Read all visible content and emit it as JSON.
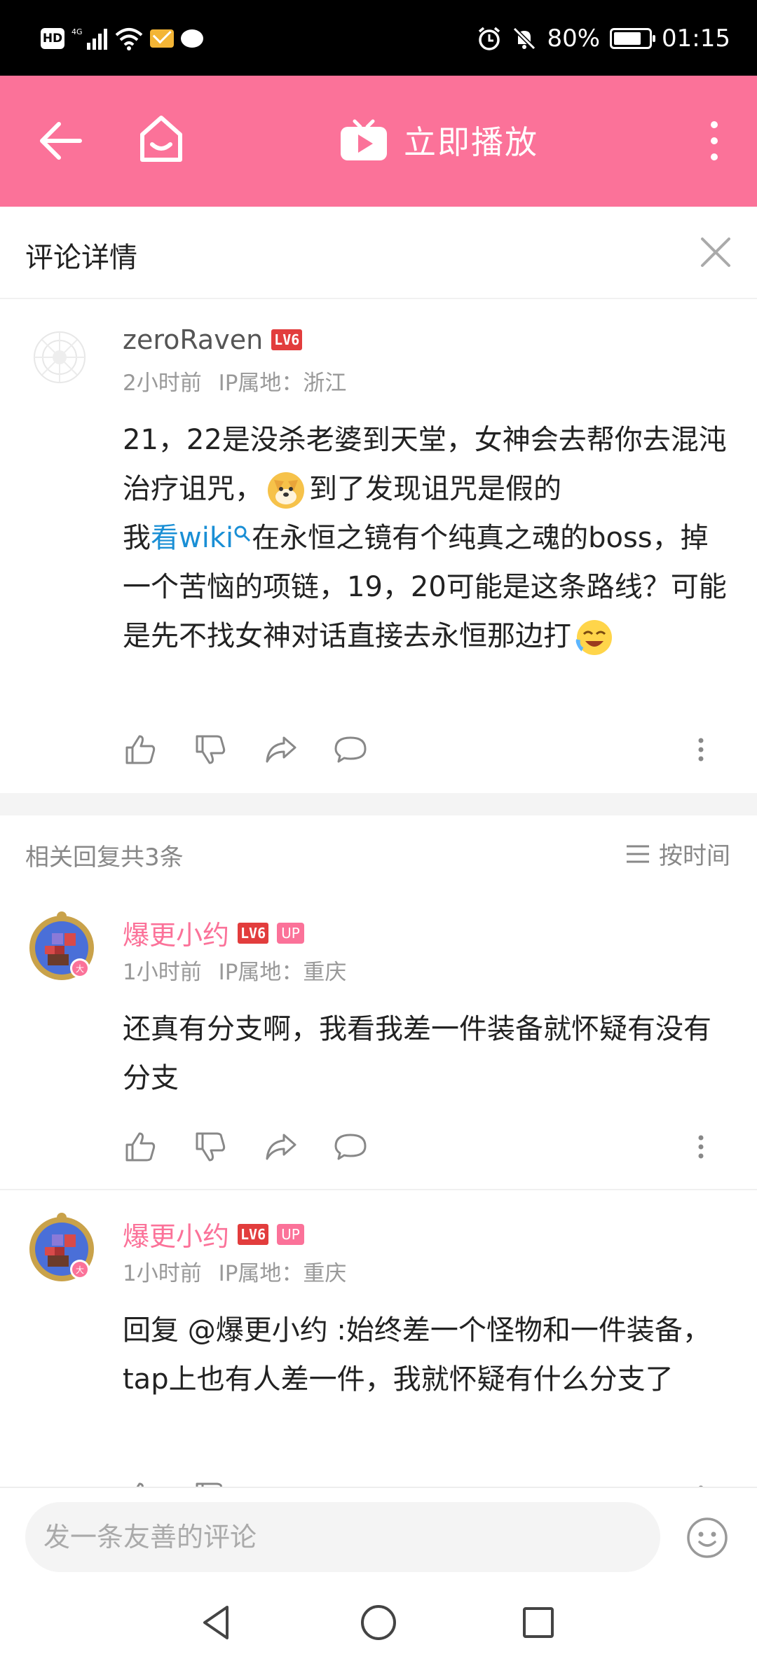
{
  "status_bar": {
    "left_icons": [
      "hd-icon",
      "signal-4g-icon",
      "wifi-icon",
      "mail-icon",
      "chat-bubble-icon"
    ],
    "hd": "HD",
    "network": "4G",
    "battery": "80%",
    "battery_level": 0.8,
    "time": "01:15"
  },
  "app_bar": {
    "title": "立即播放",
    "accent_color": "#fb7299"
  },
  "section": {
    "title": "评论详情"
  },
  "main_comment": {
    "username": "zeroRaven",
    "level": "LV6",
    "time": "2小时前",
    "ip": "IP属地：浙江",
    "text_1": "21，22是没杀老婆到天堂，女神会去帮你去混沌治疗诅咒，",
    "text_2": "到了发现诅咒是假的",
    "text_3": "我",
    "link": "看wiki",
    "text_4": "在永恒之镜有个纯真之魂的boss，掉一个苦恼的项链，19，20可能是这条路线？可能是先不找女神对话直接去永恒那边打"
  },
  "replies_header": {
    "count": "相关回复共3条",
    "sort": "按时间"
  },
  "replies": [
    {
      "username": "爆更小约",
      "level": "LV6",
      "badge": "UP",
      "time": "1小时前",
      "ip": "IP属地：重庆",
      "text": "还真有分支啊，我看我差一件装备就怀疑有没有分支"
    },
    {
      "username": "爆更小约",
      "level": "LV6",
      "badge": "UP",
      "time": "1小时前",
      "ip": "IP属地：重庆",
      "reply_prefix": "回复 ",
      "mention": "@爆更小约",
      "text": " :始终差一个怪物和一件装备，tap上也有人差一件，我就怀疑有什么分支了"
    }
  ],
  "input": {
    "placeholder": "发一条友善的评论"
  }
}
